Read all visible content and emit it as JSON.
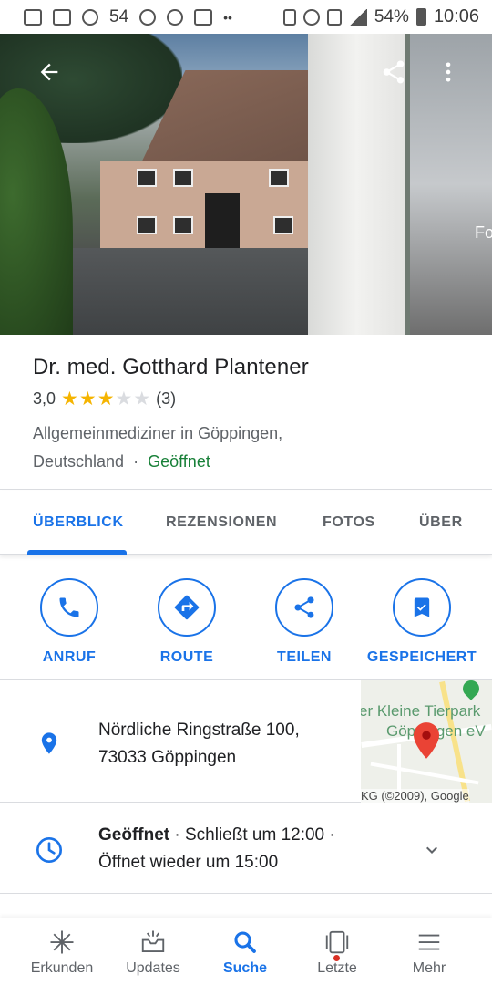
{
  "status_bar": {
    "notification_count": "54",
    "battery": "54%",
    "time": "10:06"
  },
  "hero": {
    "next_photo_label": "Fo"
  },
  "place": {
    "name": "Dr. med. Gotthard Plantener",
    "rating": "3,0",
    "rating_value": 3,
    "rating_max": 5,
    "review_count": "(3)",
    "category_line1": "Allgemeinmediziner in Göppingen,",
    "category_line2_location": "Deutschland",
    "separator": "·",
    "status": "Geöffnet"
  },
  "tabs": [
    {
      "label": "ÜBERBLICK",
      "active": true
    },
    {
      "label": "REZENSIONEN",
      "active": false
    },
    {
      "label": "FOTOS",
      "active": false
    },
    {
      "label": "ÜBER",
      "active": false
    }
  ],
  "actions": [
    {
      "label": "ANRUF",
      "icon": "phone-icon"
    },
    {
      "label": "ROUTE",
      "icon": "directions-icon"
    },
    {
      "label": "TEILEN",
      "icon": "share-icon"
    },
    {
      "label": "GESPEICHERT",
      "icon": "saved-bookmark-icon"
    }
  ],
  "address": {
    "line1": "Nördliche Ringstraße 100,",
    "line2": "73033 Göppingen",
    "map_label1": "er Kleine Tierpark",
    "map_label2": "Göppingen eV",
    "map_copyright": "KG (©2009), Google"
  },
  "hours": {
    "status": "Geöffnet",
    "detail1": " · Schließt um 12:00 ·",
    "detail2": "Öffnet wieder um 15:00"
  },
  "bottom_nav": [
    {
      "label": "Erkunden",
      "icon": "explore-icon",
      "active": false
    },
    {
      "label": "Updates",
      "icon": "updates-icon",
      "active": false
    },
    {
      "label": "Suche",
      "icon": "search-icon",
      "active": true
    },
    {
      "label": "Letzte",
      "icon": "recent-icon",
      "active": false
    },
    {
      "label": "Mehr",
      "icon": "menu-icon",
      "active": false
    }
  ],
  "colors": {
    "accent": "#1a73e8",
    "open_green": "#188038",
    "star": "#f5b400",
    "pin_red": "#ea4335"
  }
}
